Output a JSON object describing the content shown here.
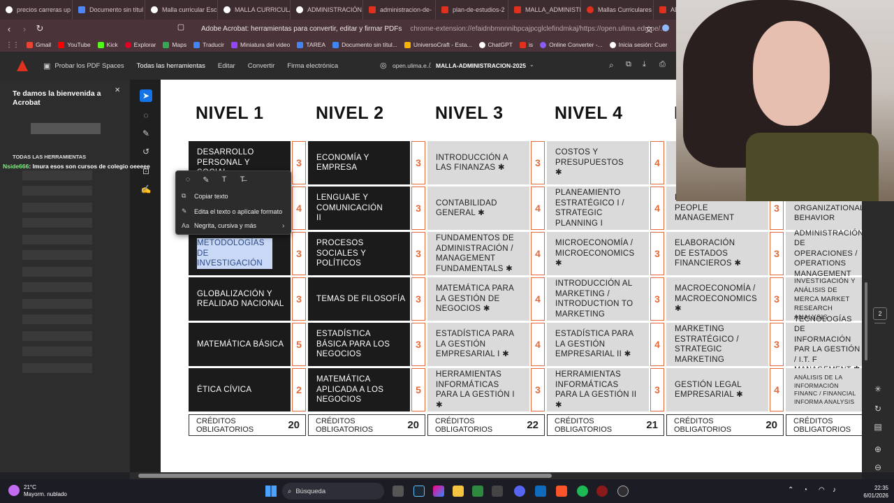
{
  "tabs": [
    {
      "label": "precios carreras up",
      "color": "#ffffff"
    },
    {
      "label": "Documento sin títul",
      "color": "#4f86f7"
    },
    {
      "label": "Malla curricular Esc",
      "color": "#ffffff"
    },
    {
      "label": "MALLA CURRICULA",
      "color": "#ffffff"
    },
    {
      "label": "ADMINISTRACIÓN",
      "color": "#ffffff"
    },
    {
      "label": "administracion-de-",
      "color": "#e0301e"
    },
    {
      "label": "plan-de-estudios-2",
      "color": "#e0301e"
    },
    {
      "label": "MALLA_ADMINISTR",
      "color": "#e0301e"
    },
    {
      "label": "Mallas Curriculares",
      "color": "#e0301e"
    },
    {
      "label": "ADI",
      "color": "#e0301e"
    }
  ],
  "addressbar": {
    "title": "Adobe Acrobat: herramientas para convertir, editar y firmar PDFs",
    "url": "chrome-extension://efaidnbmnnnibpcajpcglclefindmkaj/https://open.ulima.edu.pe/..."
  },
  "bookmarks": [
    {
      "label": "Gmail",
      "color": "#ea4335"
    },
    {
      "label": "YouTube",
      "color": "#ff0000"
    },
    {
      "label": "Kick",
      "color": "#53fc18"
    },
    {
      "label": "Explorar",
      "color": "#e60023"
    },
    {
      "label": "Maps",
      "color": "#34a853"
    },
    {
      "label": "Traducir",
      "color": "#4285f4"
    },
    {
      "label": "Miniatura del video",
      "color": "#9146ff"
    },
    {
      "label": "TAREA",
      "color": "#4285f4"
    },
    {
      "label": "Documento sin títul...",
      "color": "#4285f4"
    },
    {
      "label": "UniversoCraft - Esta...",
      "color": "#f4b400"
    },
    {
      "label": "ChatGPT",
      "color": "#ffffff"
    },
    {
      "label": "is",
      "color": "#e0301e"
    },
    {
      "label": "Online Converter -...",
      "color": "#8a5cf6"
    },
    {
      "label": "Inicia sesión: Cuer",
      "color": "#ffffff"
    }
  ],
  "acrobat": {
    "spaces": "Probar los PDF Spaces",
    "all_tools": "Todas las herramientas",
    "edit": "Editar",
    "convert": "Convertir",
    "sign": "Firma electrónica",
    "domain": "open.ulima.e...",
    "filename": "MALLA-ADMINISTRACION-2025"
  },
  "leftpanel": {
    "welcome": "Te damos la bienvenida a Acrobat",
    "tools_label": "TODAS LAS HERRAMIENTAS"
  },
  "chat": {
    "user": "Nside666",
    "message": ": lmura esos son cursos de colegio oeeeee"
  },
  "context_menu": {
    "copy": "Copiar texto",
    "edit": "Edita el texto o aplícale formato",
    "format": "Negrita, cursiva y más"
  },
  "levels": [
    "NIVEL 1",
    "NIVEL 2",
    "NIVEL 3",
    "NIVEL 4"
  ],
  "courses": {
    "col1": [
      {
        "name": "DESARROLLO PERSONAL Y SOCIAL",
        "credits": "3"
      },
      {
        "name": "",
        "credits": "4"
      },
      {
        "name": "METODOLOGÍAS DE INVESTIGACIÓN",
        "credits": "3"
      },
      {
        "name": "GLOBALIZACIÓN Y REALIDAD NACIONAL",
        "credits": "3"
      },
      {
        "name": "MATEMÁTICA BÁSICA",
        "credits": "5"
      },
      {
        "name": "ÉTICA CÍVICA",
        "credits": "2"
      }
    ],
    "col2": [
      {
        "name": "ECONOMÍA Y EMPRESA",
        "credits": "3"
      },
      {
        "name": "LENGUAJE Y COMUNICACIÓN II",
        "credits": "3"
      },
      {
        "name": "PROCESOS SOCIALES Y POLÍTICOS",
        "credits": "3"
      },
      {
        "name": "TEMAS DE FILOSOFÍA",
        "credits": "3"
      },
      {
        "name": "ESTADÍSTICA BÁSICA PARA LOS NEGOCIOS",
        "credits": "3"
      },
      {
        "name": "MATEMÁTICA APLICADA A LOS NEGOCIOS",
        "credits": "5"
      }
    ],
    "col3": [
      {
        "name": "INTRODUCCIÓN A LAS FINANZAS ✱",
        "credits": "3"
      },
      {
        "name": "CONTABILIDAD GENERAL ✱",
        "credits": "4"
      },
      {
        "name": "FUNDAMENTOS DE ADMINISTRACIÓN / MANAGEMENT FUNDAMENTALS ✱",
        "credits": "4"
      },
      {
        "name": "MATEMÁTICA PARA LA GESTIÓN DE NEGOCIOS ✱",
        "credits": "4"
      },
      {
        "name": "ESTADÍSTICA PARA LA GESTIÓN EMPRESARIAL I ✱",
        "credits": "4"
      },
      {
        "name": "HERRAMIENTAS INFORMÁTICAS PARA LA GESTIÓN I ✱",
        "credits": "3"
      }
    ],
    "col4": [
      {
        "name": "COSTOS Y PRESUPUESTOS ✱",
        "credits": "4"
      },
      {
        "name": "PLANEAMIENTO ESTRATÉGICO I / STRATEGIC PLANNING I",
        "credits": "4"
      },
      {
        "name": "MICROECONOMÍA / MICROECONOMICS ✱",
        "credits": "3"
      },
      {
        "name": "INTRODUCCIÓN AL MARKETING / INTRODUCTION TO MARKETING",
        "credits": "3"
      },
      {
        "name": "ESTADÍSTICA PARA LA GESTIÓN EMPRESARIAL II ✱",
        "credits": "4"
      },
      {
        "name": "HERRAMIENTAS INFORMÁTICAS PARA LA GESTIÓN II ✱",
        "credits": "3"
      }
    ],
    "col5": [
      {
        "name": "",
        "credits": ""
      },
      {
        "name": "PERSONAS / PEOPLE MANAGEMENT",
        "credits": "3"
      },
      {
        "name": "ELABORACIÓN DE ESTADOS FINANCIEROS ✱",
        "credits": "3"
      },
      {
        "name": "MACROECONOMÍA / MACROECONOMICS ✱",
        "credits": "3"
      },
      {
        "name": "MARKETING ESTRATÉGICO / STRATEGIC MARKETING",
        "credits": "3"
      },
      {
        "name": "GESTIÓN LEGAL EMPRESARIAL ✱",
        "credits": "4"
      }
    ],
    "col6": [
      {
        "name": "",
        "credits": ""
      },
      {
        "name": "ORGANIZACIONAL ORGANIZATIONAL BEHAVIOR",
        "credits": ""
      },
      {
        "name": "ADMINISTRACIÓN DE OPERACIONES / OPERATIONS MANAGEMENT",
        "credits": ""
      },
      {
        "name": "INVESTIGACIÓN Y ANÁLISIS DE MERCA MARKET RESEARCH ANALYSIS",
        "credits": ""
      },
      {
        "name": "TECNOLOGÍAS DE INFORMACIÓN PAR LA GESTIÓN / I.T. F MANAGEMENT ✱",
        "credits": ""
      },
      {
        "name": "ANÁLISIS DE LA INFORMACIÓN FINANC / FINANCIAL INFORMA ANALYSIS",
        "credits": ""
      }
    ]
  },
  "totals": {
    "label": "CRÉDITOS OBLIGATORIOS",
    "values": [
      "20",
      "20",
      "22",
      "21",
      "20",
      ""
    ]
  },
  "page_number": "2",
  "taskbar": {
    "temp": "21°C",
    "weather": "Mayorm. nublado",
    "search": "Búsqueda",
    "time": "22:35",
    "date": "6/01/2026"
  },
  "colors": {
    "accent": "#e46a3a",
    "dark_cell": "#1b1b1b",
    "light_cell": "#dadada"
  }
}
